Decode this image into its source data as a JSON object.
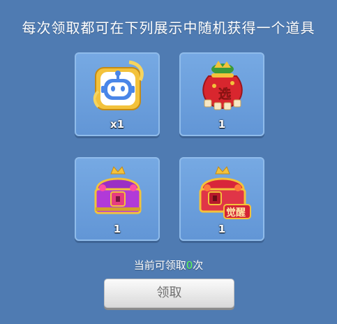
{
  "title": "每次领取都可在下列展示中随机获得一个道具",
  "items": [
    {
      "name": "robot-avatar-frame",
      "count": "x1"
    },
    {
      "name": "lucky-bag",
      "count": "1",
      "badge": "选"
    },
    {
      "name": "purple-treasure-chest",
      "count": "1"
    },
    {
      "name": "red-treasure-chest",
      "count": "1",
      "badge": "觉醒"
    }
  ],
  "remaining": {
    "prefix": "当前可领取",
    "count": "0",
    "suffix": "次"
  },
  "claim_button": "领取",
  "colors": {
    "background": "#4f7bb2",
    "card": "#6b9edc",
    "highlight": "#5dff5d"
  }
}
